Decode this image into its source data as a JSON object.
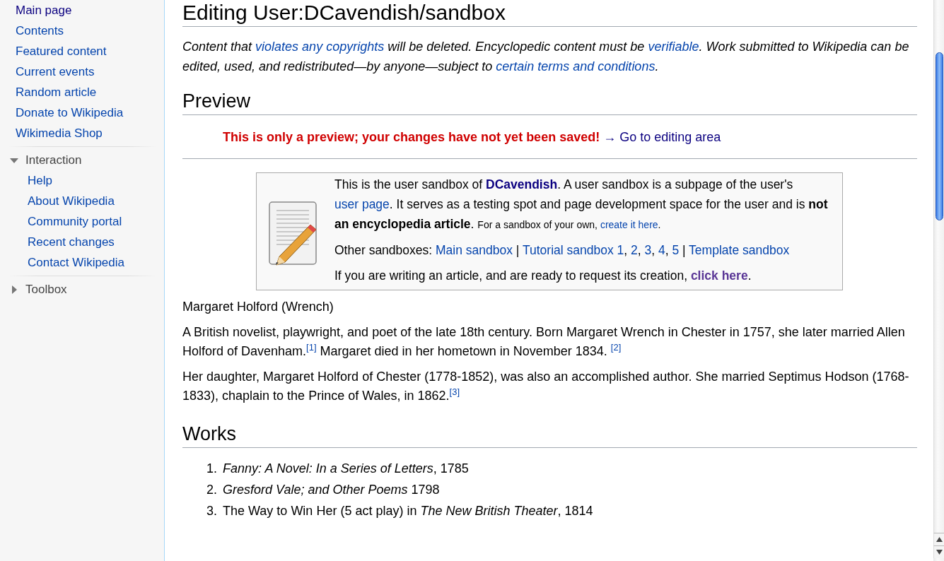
{
  "sidebar": {
    "navigation": [
      {
        "label": "Main page",
        "visited": true
      },
      {
        "label": "Contents",
        "visited": false
      },
      {
        "label": "Featured content",
        "visited": false
      },
      {
        "label": "Current events",
        "visited": false
      },
      {
        "label": "Random article",
        "visited": false
      },
      {
        "label": "Donate to Wikipedia",
        "visited": false
      },
      {
        "label": "Wikimedia Shop",
        "visited": false
      }
    ],
    "portals": [
      {
        "title": "Interaction",
        "expanded": true,
        "items": [
          "Help",
          "About Wikipedia",
          "Community portal",
          "Recent changes",
          "Contact Wikipedia"
        ]
      },
      {
        "title": "Toolbox",
        "expanded": false
      }
    ]
  },
  "page": {
    "title": "Editing User:DCavendish/sandbox",
    "notice": [
      {
        "kind": "text",
        "text": "Content that "
      },
      {
        "kind": "link",
        "text": "violates any copyrights"
      },
      {
        "kind": "text",
        "text": " will be deleted. Encyclopedic content must be "
      },
      {
        "kind": "link",
        "text": "verifiable"
      },
      {
        "kind": "text",
        "text": ". Work submitted to Wikipedia can be edited, used, and redistributed—by anyone—subject to "
      },
      {
        "kind": "link",
        "text": "certain terms and conditions"
      },
      {
        "kind": "text",
        "text": "."
      }
    ],
    "preview_heading": "Preview",
    "preview_warning": "This is only a preview; your changes have not yet been saved!",
    "preview_link": "→ Go to editing area",
    "sandbox_box": [
      [
        {
          "kind": "text",
          "text": "This is the user sandbox of "
        },
        {
          "kind": "user-link",
          "text": "DCavendish"
        },
        {
          "kind": "text",
          "text": ". A user sandbox is a subpage of the user's "
        },
        {
          "kind": "link",
          "text": "user page"
        },
        {
          "kind": "text",
          "text": ". It serves as a testing spot and page development space for the user and is **not an encyclopedia article**. "
        },
        {
          "kind": "small",
          "text": "For a sandbox of your own, "
        },
        {
          "kind": "small-link",
          "text": "create it here"
        },
        {
          "kind": "small",
          "text": "."
        }
      ],
      [
        {
          "kind": "text",
          "text": "Other sandboxes: "
        },
        {
          "kind": "link",
          "text": "Main sandbox"
        },
        {
          "kind": "text",
          "text": " | "
        },
        {
          "kind": "link",
          "text": "Tutorial sandbox 1"
        },
        {
          "kind": "text",
          "text": ", "
        },
        {
          "kind": "link",
          "text": "2"
        },
        {
          "kind": "text",
          "text": ", "
        },
        {
          "kind": "link",
          "text": "3"
        },
        {
          "kind": "text",
          "text": ", "
        },
        {
          "kind": "link",
          "text": "4"
        },
        {
          "kind": "text",
          "text": ", "
        },
        {
          "kind": "link",
          "text": "5"
        },
        {
          "kind": "text",
          "text": " | "
        },
        {
          "kind": "link",
          "text": "Template sandbox"
        }
      ],
      [
        {
          "kind": "text",
          "text": "If you are writing an article, and are ready to request its creation, "
        },
        {
          "kind": "visited-link",
          "text": "click here"
        },
        {
          "kind": "text",
          "text": "."
        }
      ]
    ],
    "body": [
      [
        {
          "kind": "text",
          "text": "Margaret Holford (Wrench)"
        }
      ],
      [
        {
          "kind": "text",
          "text": "A British novelist, playwright, and poet of the late 18th century. Born Margaret Wrench in Chester in 1757, she later married Allen Holford of Davenham."
        },
        {
          "kind": "ref",
          "text": "[1]"
        },
        {
          "kind": "text",
          "text": " Margaret died in her hometown in November 1834. "
        },
        {
          "kind": "ref",
          "text": "[2]"
        }
      ],
      [
        {
          "kind": "text",
          "text": "Her daughter, Margaret Holford of Chester (1778-1852), was also an accomplished author. She married Septimus Hodson (1768-1833), chaplain to the Prince of Wales, in 1862."
        },
        {
          "kind": "ref",
          "text": "[3]"
        }
      ]
    ],
    "works_heading": "Works",
    "works": [
      {
        "number": "1.",
        "text": "*Fanny: A Novel: In a Series of Letters*, 1785"
      },
      {
        "number": "2.",
        "text": "*Gresford Vale; and Other Poems* 1798"
      },
      {
        "number": "3.",
        "text": "The Way to Win Her (5 act play) in *The New British Theater*, 1814"
      }
    ]
  }
}
